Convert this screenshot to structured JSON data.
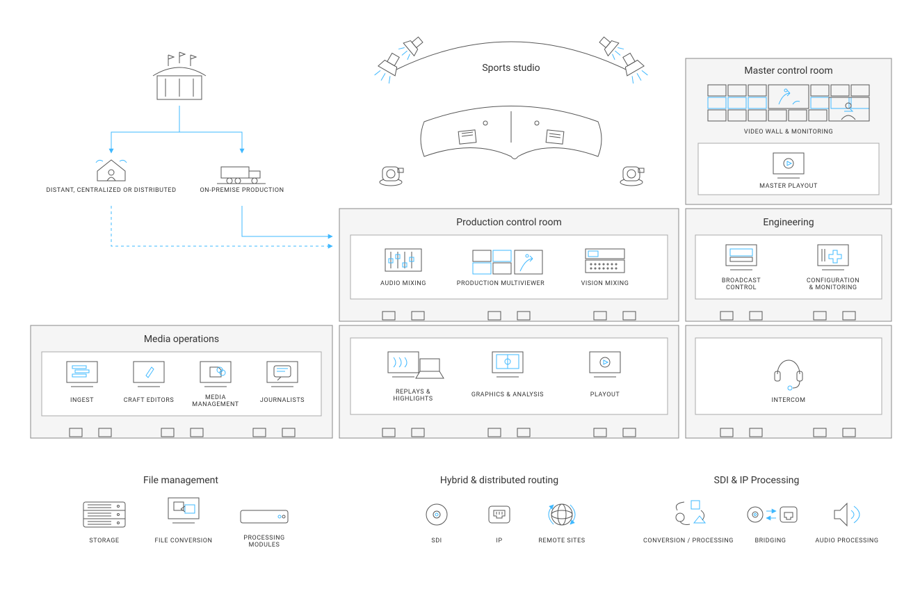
{
  "top": {
    "studio_title": "Sports studio",
    "distant": "DISTANT, CENTRALIZED OR DISTRIBUTED",
    "onpremise": "ON-PREMISE PRODUCTION"
  },
  "mcr": {
    "title": "Master control room",
    "wall": "VIDEO WALL & MONITORING",
    "playout": "MASTER PLAYOUT"
  },
  "pcr": {
    "title": "Production control room",
    "audio": "AUDIO MIXING",
    "mv": "PRODUCTION MULTIVIEWER",
    "vision": "VISION MIXING",
    "replay": "REPLAYS & HIGHLIGHTS",
    "gfx": "GRAPHICS & ANALYSIS",
    "playout": "PLAYOUT"
  },
  "eng": {
    "title": "Engineering",
    "bc": "BROADCAST CONTROL",
    "cfg": "CONFIGURATION & MONITORING",
    "intercom": "INTERCOM"
  },
  "media": {
    "title": "Media operations",
    "ingest": "INGEST",
    "craft": "CRAFT EDITORS",
    "mm": "MEDIA MANAGEMENT",
    "journo": "JOURNALISTS"
  },
  "file": {
    "title": "File management",
    "storage": "STORAGE",
    "conv": "FILE CONVERSION",
    "proc": "PROCESSING MODULES"
  },
  "routing": {
    "title": "Hybrid & distributed routing",
    "sdi": "SDI",
    "ip": "IP",
    "remote": "REMOTE SITES"
  },
  "sdi": {
    "title": "SDI & IP Processing",
    "conv": "CONVERSION / PROCESSING",
    "bridge": "BRIDGING",
    "audio": "AUDIO PROCESSING"
  }
}
